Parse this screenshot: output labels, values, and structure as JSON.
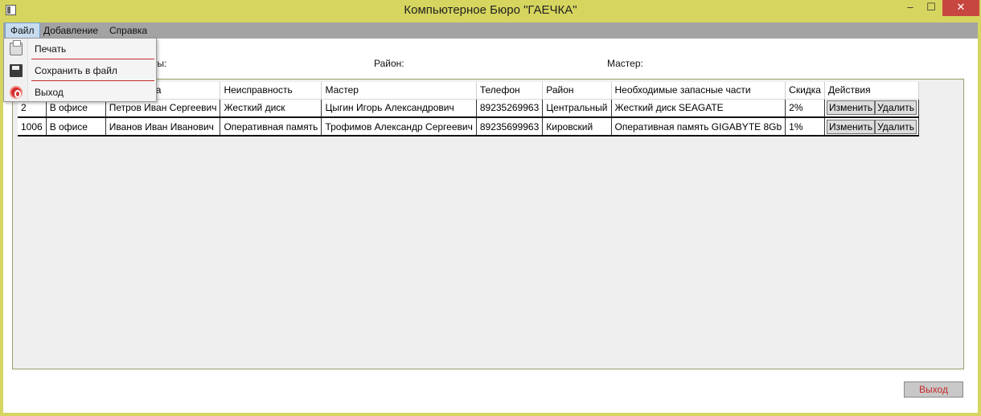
{
  "window": {
    "title": "Компьютерное Бюро \"ГАЕЧКА\"",
    "minimize_label": "–",
    "maximize_label": "☐",
    "close_label": "✕"
  },
  "menu": {
    "file": "Файл",
    "add": "Добавление",
    "help": "Справка"
  },
  "file_menu": {
    "print": "Печать",
    "save": "Сохранить в файл",
    "exit": "Выход"
  },
  "filters": {
    "partial_label": "ты:",
    "district_label": "Район:",
    "master_label": "Мастер:"
  },
  "grid": {
    "columns": [
      "",
      "",
      "нта",
      "Неисправность",
      "Мастер",
      "Телефон",
      "Район",
      "Необходимые запасные части",
      "Скидка",
      "Действия"
    ],
    "rows": [
      {
        "id": "2",
        "location": "В офисе",
        "client": "Петров Иван Сергеевич",
        "fault": "Жесткий диск",
        "master": "Цыгин Игорь Александрович",
        "phone": "89235269963",
        "district": "Центральный",
        "parts": "Жесткий диск SEAGATE",
        "discount": "2%",
        "edit": "Изменить",
        "delete": "Удалить"
      },
      {
        "id": "1006",
        "location": "В офисе",
        "client": "Иванов Иван Иванович",
        "fault": "Оперативная память",
        "master": "Трофимов Александр Сергеевич",
        "phone": "89235699963",
        "district": "Кировский",
        "parts": "Оперативная память GIGABYTE 8Gb",
        "discount": "1%",
        "edit": "Изменить",
        "delete": "Удалить"
      }
    ]
  },
  "footer": {
    "exit_button": "Выход"
  },
  "icons": {
    "print": "printer-icon",
    "save": "floppy-disk-icon",
    "exit": "power-exit-icon"
  },
  "colors": {
    "frame": "#d6d55f",
    "menubar": "#a3a3a3",
    "exit_text": "#c62828",
    "separator": "#c62828"
  }
}
